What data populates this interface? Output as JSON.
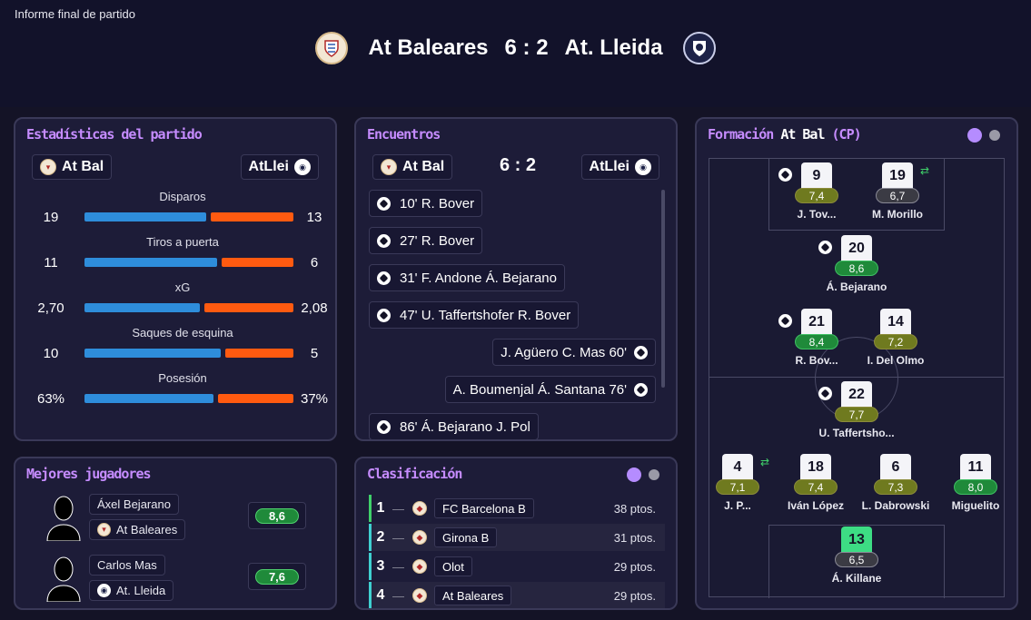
{
  "header": {
    "report_label": "Informe final de partido",
    "home_team": "At Baleares",
    "score": "6 : 2",
    "away_team": "At. Lleida"
  },
  "stats_panel": {
    "title": "Estadísticas del partido",
    "home_short": "At Bal",
    "away_short": "AtLlei",
    "rows": [
      {
        "label": "Disparos",
        "home": "19",
        "away": "13",
        "home_frac": 0.594
      },
      {
        "label": "Tiros a puerta",
        "home": "11",
        "away": "6",
        "home_frac": 0.647
      },
      {
        "label": "xG",
        "home": "2,70",
        "away": "2,08",
        "home_frac": 0.565
      },
      {
        "label": "Saques de esquina",
        "home": "10",
        "away": "5",
        "home_frac": 0.667
      },
      {
        "label": "Posesión",
        "home": "63%",
        "away": "37%",
        "home_frac": 0.63
      }
    ]
  },
  "events_panel": {
    "title": "Encuentros",
    "home_short": "At Bal",
    "away_short": "AtLlei",
    "score": "6 : 2",
    "events": [
      {
        "side": "home",
        "text": "10'  R. Bover"
      },
      {
        "side": "home",
        "text": "27'  R. Bover"
      },
      {
        "side": "home",
        "text": "31'  F. Andone  Á. Bejarano"
      },
      {
        "side": "home",
        "text": "47'  U. Taffertshofer  R. Bover"
      },
      {
        "side": "away",
        "text": "J. Agüero  C. Mas  60'"
      },
      {
        "side": "away",
        "text": "A. Boumenjal  Á. Santana  76'"
      },
      {
        "side": "home",
        "text": "86'  Á. Bejarano  J. Pol"
      }
    ]
  },
  "formation_panel": {
    "title_prefix": "Formación",
    "title_team": "At Bal",
    "title_suffix": "(CP)",
    "players": [
      {
        "num": "9",
        "rating": "7,4",
        "name": "J. Tov...",
        "style": "olive",
        "goal": true
      },
      {
        "num": "19",
        "rating": "6,7",
        "name": "M. Morillo",
        "style": "grey",
        "sub": true
      },
      {
        "num": "20",
        "rating": "8,6",
        "name": "Á. Bejarano",
        "style": "green",
        "goal": true
      },
      {
        "num": "21",
        "rating": "8,4",
        "name": "R. Bov...",
        "style": "green",
        "goal": true
      },
      {
        "num": "14",
        "rating": "7,2",
        "name": "I. Del Olmo",
        "style": "olive"
      },
      {
        "num": "22",
        "rating": "7,7",
        "name": "U. Taffertsho...",
        "style": "olive",
        "goal": true
      },
      {
        "num": "4",
        "rating": "7,1",
        "name": "J. P...",
        "style": "olive",
        "sub": true
      },
      {
        "num": "18",
        "rating": "7,4",
        "name": "Iván López",
        "style": "olive"
      },
      {
        "num": "6",
        "rating": "7,3",
        "name": "L. Dabrowski",
        "style": "olive"
      },
      {
        "num": "11",
        "rating": "8,0",
        "name": "Miguelito",
        "style": "green"
      },
      {
        "num": "13",
        "rating": "6,5",
        "name": "Á. Killane",
        "style": "grey",
        "gk": true
      }
    ]
  },
  "best_players": {
    "title": "Mejores jugadores",
    "players": [
      {
        "name": "Áxel Bejarano",
        "team": "At Baleares",
        "rating": "8,6"
      },
      {
        "name": "Carlos Mas",
        "team": "At. Lleida",
        "rating": "7,6"
      }
    ]
  },
  "table_panel": {
    "title": "Clasificación",
    "rows": [
      {
        "pos": "1",
        "team": "FC Barcelona B",
        "pts": "38 ptos.",
        "indicator": "#3fd06a"
      },
      {
        "pos": "2",
        "team": "Girona B",
        "pts": "31 ptos.",
        "indicator": "#3fd0d0"
      },
      {
        "pos": "3",
        "team": "Olot",
        "pts": "29 ptos.",
        "indicator": "#3fd0d0"
      },
      {
        "pos": "4",
        "team": "At Baleares",
        "pts": "29 ptos.",
        "indicator": "#3fd0d0"
      }
    ]
  },
  "colors": {
    "accent": "#c68cff",
    "home_bar": "#2e8ddb",
    "away_bar": "#ff5a10",
    "rating_green": "#1f8a3a",
    "rating_olive": "#6f7a1f"
  },
  "icons": [
    "ball-icon",
    "substitution-icon",
    "club-crest-icon",
    "player-silhouette-icon"
  ]
}
